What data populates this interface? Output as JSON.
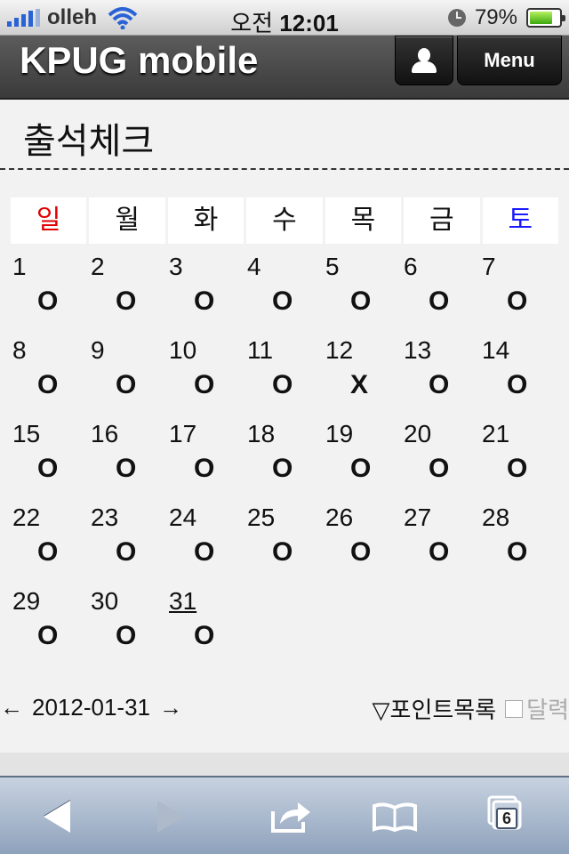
{
  "status_bar": {
    "carrier": "olleh",
    "time_prefix": "오전",
    "time": "12:01",
    "battery_percent": "79%",
    "battery_level": 0.79
  },
  "header": {
    "site_title": "KPUG mobile",
    "menu_label": "Menu",
    "user_icon": "user-icon"
  },
  "page": {
    "title": "출석체크"
  },
  "calendar": {
    "weekdays": [
      "일",
      "월",
      "화",
      "수",
      "목",
      "금",
      "토"
    ],
    "days": [
      {
        "day": "1",
        "mark": "O"
      },
      {
        "day": "2",
        "mark": "O"
      },
      {
        "day": "3",
        "mark": "O"
      },
      {
        "day": "4",
        "mark": "O"
      },
      {
        "day": "5",
        "mark": "O"
      },
      {
        "day": "6",
        "mark": "O"
      },
      {
        "day": "7",
        "mark": "O"
      },
      {
        "day": "8",
        "mark": "O"
      },
      {
        "day": "9",
        "mark": "O"
      },
      {
        "day": "10",
        "mark": "O"
      },
      {
        "day": "11",
        "mark": "O"
      },
      {
        "day": "12",
        "mark": "X"
      },
      {
        "day": "13",
        "mark": "O"
      },
      {
        "day": "14",
        "mark": "O"
      },
      {
        "day": "15",
        "mark": "O"
      },
      {
        "day": "16",
        "mark": "O"
      },
      {
        "day": "17",
        "mark": "O"
      },
      {
        "day": "18",
        "mark": "O"
      },
      {
        "day": "19",
        "mark": "O"
      },
      {
        "day": "20",
        "mark": "O"
      },
      {
        "day": "21",
        "mark": "O"
      },
      {
        "day": "22",
        "mark": "O"
      },
      {
        "day": "23",
        "mark": "O"
      },
      {
        "day": "24",
        "mark": "O"
      },
      {
        "day": "25",
        "mark": "O"
      },
      {
        "day": "26",
        "mark": "O"
      },
      {
        "day": "27",
        "mark": "O"
      },
      {
        "day": "28",
        "mark": "O"
      },
      {
        "day": "29",
        "mark": "O"
      },
      {
        "day": "30",
        "mark": "O"
      },
      {
        "day": "31",
        "mark": "O",
        "today": true
      }
    ]
  },
  "date_nav": {
    "prev": "←",
    "date": "2012-01-31",
    "next": "→"
  },
  "extras": {
    "points_link": "▽포인트목록",
    "calendar_toggle": "달력"
  },
  "toolbar": {
    "pages_count": "6",
    "icons": [
      "back-arrow-icon",
      "forward-arrow-icon",
      "share-icon",
      "bookmarks-icon",
      "pages-icon"
    ]
  },
  "colors": {
    "sunday": "#e00000",
    "saturday": "#1a1aff",
    "signal_blue": "#2a63d6"
  }
}
